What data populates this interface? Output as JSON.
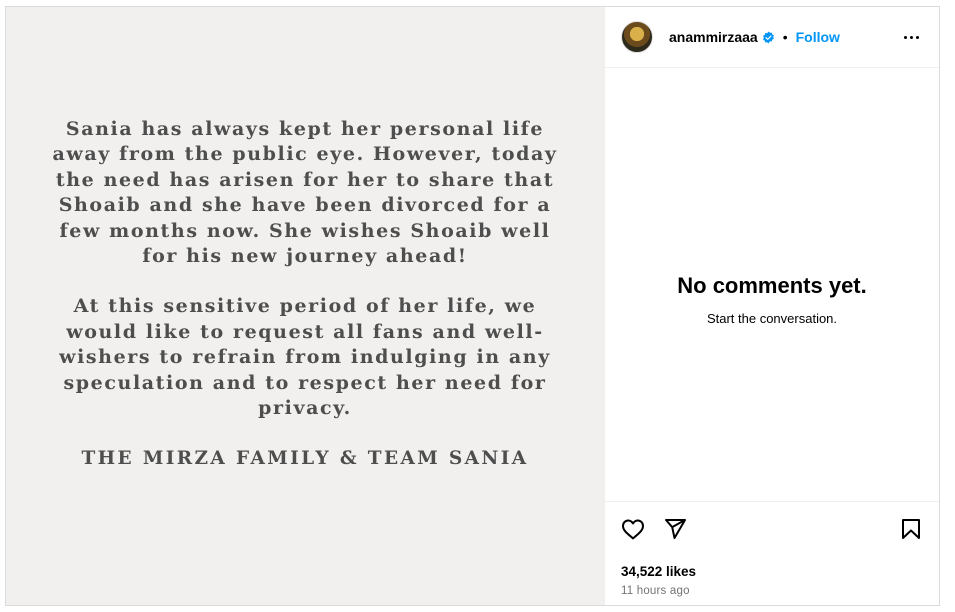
{
  "post": {
    "statement": {
      "paragraph1": "Sania has always kept her personal life away from the public eye. However, today the need has arisen for her to share that Shoaib and she have been divorced for a few months now. She wishes Shoaib well for his new journey ahead!",
      "paragraph2": "At this sensitive period of her life, we would like to  request all fans and well-wishers to refrain from indulging in any speculation and to respect her need for privacy.",
      "signature": "THE MIRZA FAMILY & TEAM SANIA"
    },
    "header": {
      "username": "anammirzaaa",
      "dot": "•",
      "follow_label": "Follow"
    },
    "comments": {
      "empty_title": "No comments yet.",
      "empty_subtitle": "Start the conversation."
    },
    "actions": {
      "likes": "34,522 likes",
      "timestamp": "11 hours ago"
    },
    "icons": {
      "avatar": "profile-photo",
      "verified": "verified-badge-icon",
      "more": "more-options-icon",
      "like": "heart-icon",
      "share": "paper-plane-icon",
      "save": "bookmark-icon"
    },
    "colors": {
      "accent": "#0095f6",
      "muted": "#737373",
      "statement_text": "#4e4e4e",
      "media_bg": "#f1f0ee"
    }
  }
}
